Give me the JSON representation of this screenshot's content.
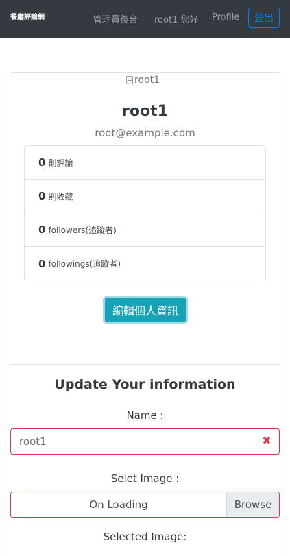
{
  "navbar": {
    "brand": "餐廳評論網",
    "admin_link": "管理員後台",
    "greeting": "root1 您好",
    "profile_link": "Profile",
    "logout_label": "登出"
  },
  "profile": {
    "avatar_alt": "root1",
    "name": "root1",
    "email": "root@example.com",
    "stats": [
      {
        "count": "0",
        "label": "則評論"
      },
      {
        "count": "0",
        "label": "則收藏"
      },
      {
        "count": "0",
        "label": "followers(追蹤者)"
      },
      {
        "count": "0",
        "label": "followings(追蹤者)"
      }
    ],
    "edit_button": "編輯個人資訊"
  },
  "form": {
    "title": "Update Your information",
    "name_label": "Name :",
    "name_value": "root1",
    "image_label": "Selet Image :",
    "file_status": "On Loading",
    "browse_label": "Browse",
    "selected_label": "Selected Image:"
  },
  "colors": {
    "navbar_bg": "#343a40",
    "primary": "#007bff",
    "info": "#17a2b8",
    "danger": "#dc3545"
  }
}
